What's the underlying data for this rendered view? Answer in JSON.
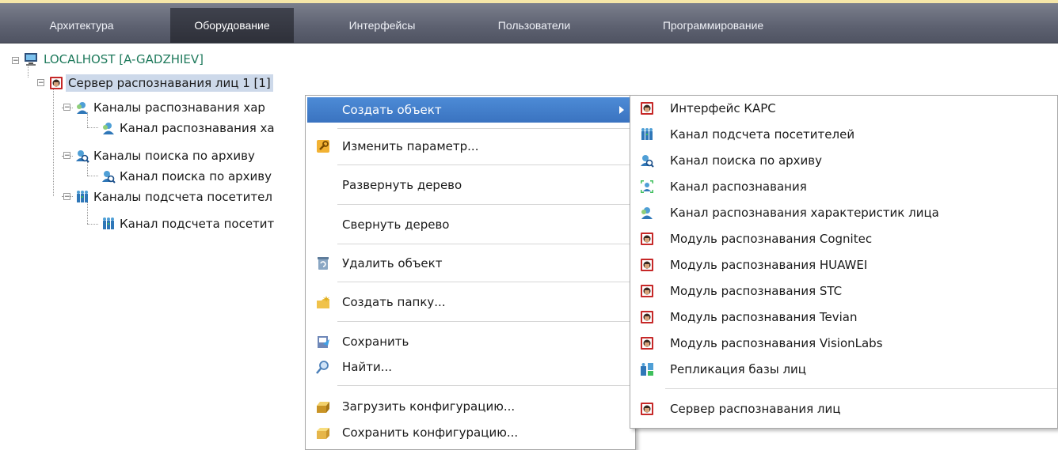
{
  "tabs": [
    {
      "label": "Архитектура"
    },
    {
      "label": "Оборудование"
    },
    {
      "label": "Интерфейсы"
    },
    {
      "label": "Пользователи"
    },
    {
      "label": "Программирование"
    }
  ],
  "tree": {
    "root": "LOCALHOST [A-GADZHIEV]",
    "server": "Сервер распознавания лиц 1 [1]",
    "items": [
      "Каналы распознавания хар",
      "Канал распознавания ха",
      "Каналы поиска по архиву",
      "Канал поиска по архиву",
      "Каналы подсчета посетител",
      "Канал подсчета посетит"
    ]
  },
  "context_menu": {
    "items": [
      "Создать объект",
      "Изменить параметр...",
      "Развернуть дерево",
      "Свернуть дерево",
      "Удалить объект",
      "Создать папку...",
      "Сохранить",
      "Найти...",
      "Загрузить конфигурацию...",
      "Сохранить конфигурацию..."
    ]
  },
  "submenu": {
    "items": [
      "Интерфейс КАРС",
      "Канал подсчета посетителей",
      "Канал поиска по архиву",
      "Канал распознавания",
      "Канал распознавания характеристик лица",
      "Модуль распознавания Cognitec",
      "Модуль распознавания HUAWEI",
      "Модуль распознавания STC",
      "Модуль распознавания Tevian",
      "Модуль распознавания VisionLabs",
      "Репликация базы лиц",
      "Сервер распознавания лиц"
    ]
  },
  "colors": {
    "tabbar": "#5d6170",
    "active_tab": "#2e3039",
    "selection": "#cdd9ea",
    "menu_highlight": "#3a73c0",
    "root_text": "#1f7a5c"
  },
  "icons": {
    "root": "computer-icon",
    "face": "face-module-icon",
    "person": "person-icon",
    "search": "archive-search-icon",
    "counter": "visitor-counter-icon"
  }
}
